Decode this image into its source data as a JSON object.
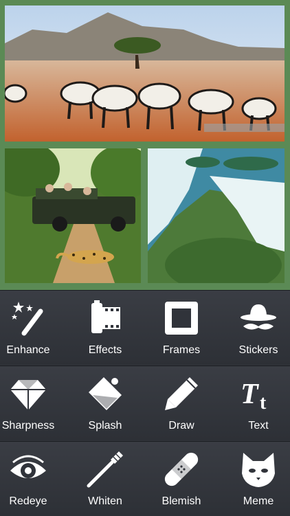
{
  "collage": {
    "photos": [
      {
        "subject": "savanna-zebras"
      },
      {
        "subject": "safari-jeep-leopard"
      },
      {
        "subject": "waterfall-gorge"
      }
    ]
  },
  "tools": {
    "enhance": "Enhance",
    "effects": "Effects",
    "frames": "Frames",
    "stickers": "Stickers",
    "sharpness": "Sharpness",
    "splash": "Splash",
    "draw": "Draw",
    "text": "Text",
    "redeye": "Redeye",
    "whiten": "Whiten",
    "blemish": "Blemish",
    "meme": "Meme"
  },
  "icons": {
    "enhance": "magic-wand-icon",
    "effects": "film-roll-icon",
    "frames": "picture-frame-icon",
    "stickers": "hat-mustache-icon",
    "sharpness": "diamond-icon",
    "splash": "paint-bucket-icon",
    "draw": "pencil-icon",
    "text": "text-tt-icon",
    "redeye": "eye-icon",
    "whiten": "toothbrush-icon",
    "blemish": "bandage-icon",
    "meme": "cat-face-icon"
  },
  "colors": {
    "collage_border": "#5b8a55",
    "toolbar_bg": "#30333a",
    "icon": "#ffffff"
  }
}
